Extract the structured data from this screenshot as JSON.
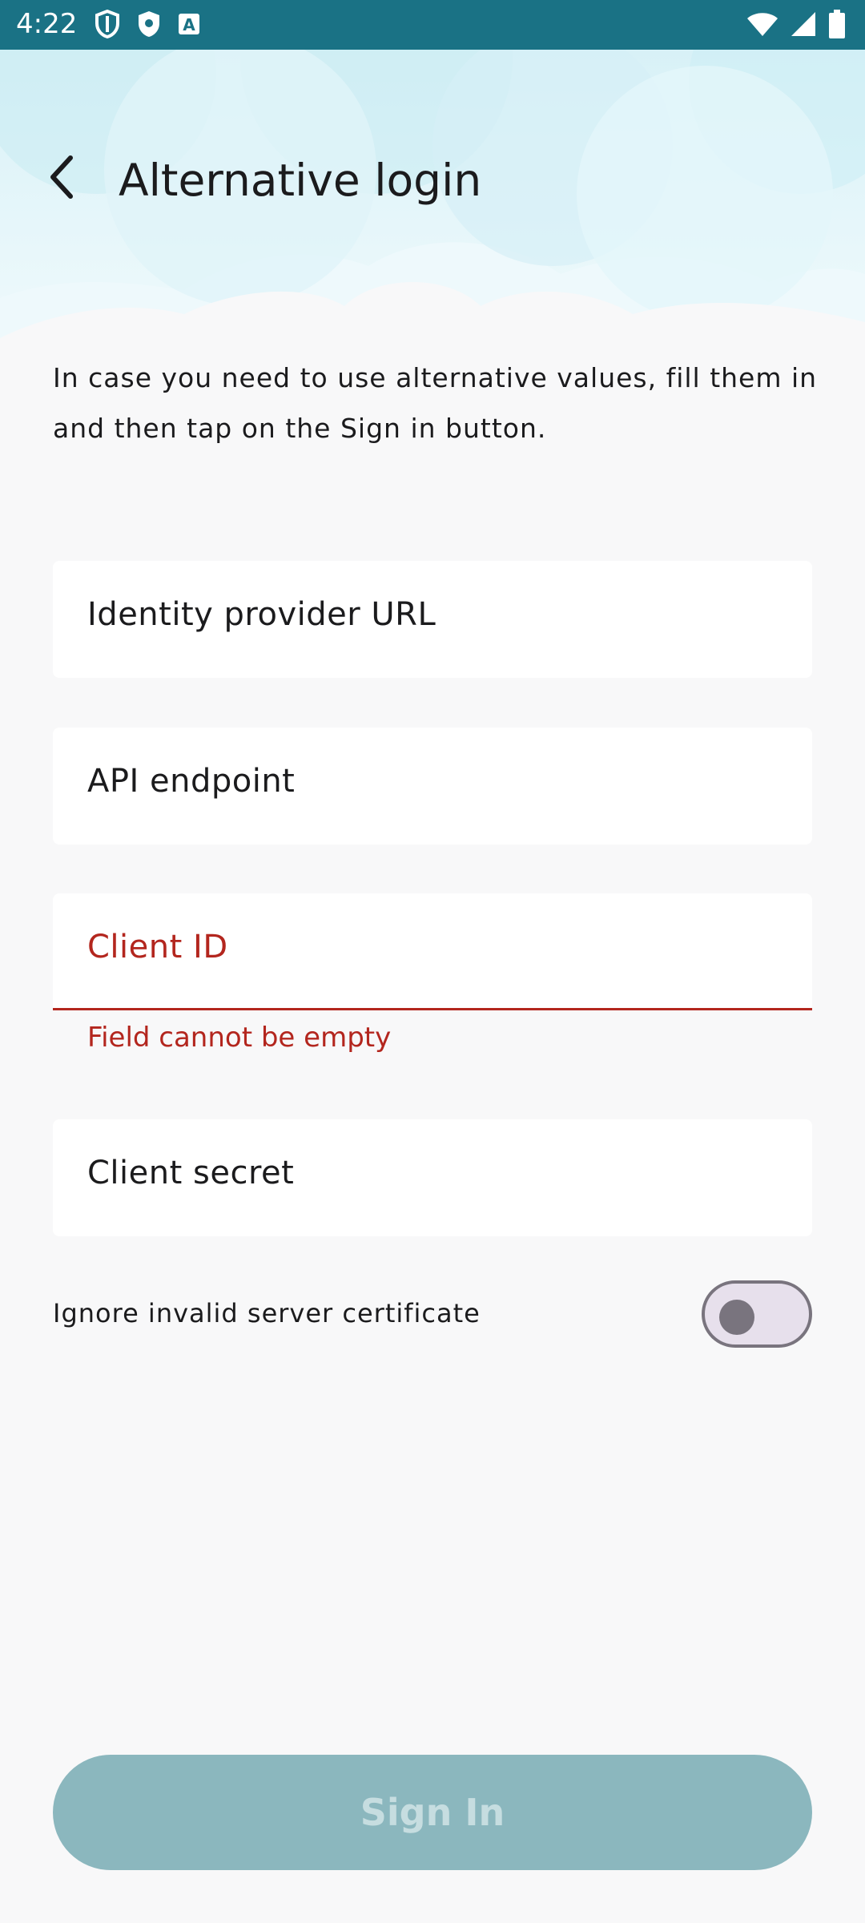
{
  "status_bar": {
    "time": "4:22",
    "left_icons": [
      "shield-outline-icon",
      "shield-filled-icon",
      "text-box-icon"
    ],
    "right_icons": [
      "wifi-icon",
      "signal-icon",
      "battery-icon"
    ],
    "background_color": "#1a7285"
  },
  "app_bar": {
    "title": "Alternative login",
    "back_icon": "back-arrow-icon"
  },
  "description": "In case you need to use alternative values, fill them in and then tap on the Sign in button.",
  "form": {
    "identity_provider_url": {
      "label": "Identity provider URL",
      "value": ""
    },
    "api_endpoint": {
      "label": "API endpoint",
      "value": ""
    },
    "client_id": {
      "label": "Client ID",
      "value": "",
      "error": "Field cannot be empty"
    },
    "client_secret": {
      "label": "Client secret",
      "value": ""
    }
  },
  "ignore_cert": {
    "label": "Ignore invalid server certificate",
    "enabled": false
  },
  "sign_in_button": {
    "label": "Sign In",
    "enabled": false
  },
  "colors": {
    "primary": "#1a7285",
    "error": "#b3261e",
    "disabled_button": "#8bb7be",
    "cloud_light": "#e8f7fb"
  }
}
